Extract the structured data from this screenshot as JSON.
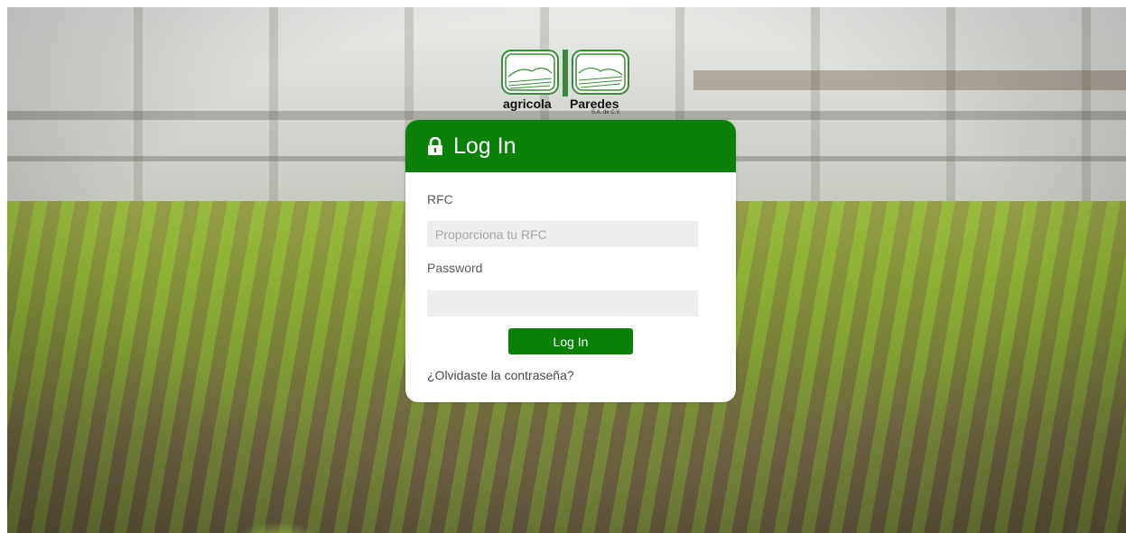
{
  "brand": {
    "name_left": "agricola",
    "name_right": "Paredes",
    "suffix": "S.A. de C.V.",
    "accent_color": "#0a8008"
  },
  "login": {
    "header_icon": "lock-icon",
    "title": "Log In",
    "rfc_label": "RFC",
    "rfc_placeholder": "Proporciona tu RFC",
    "rfc_value": "",
    "password_label": "Password",
    "password_placeholder": "",
    "password_value": "",
    "submit_label": "Log In",
    "forgot_link": "¿Olvidaste la contraseña?"
  }
}
